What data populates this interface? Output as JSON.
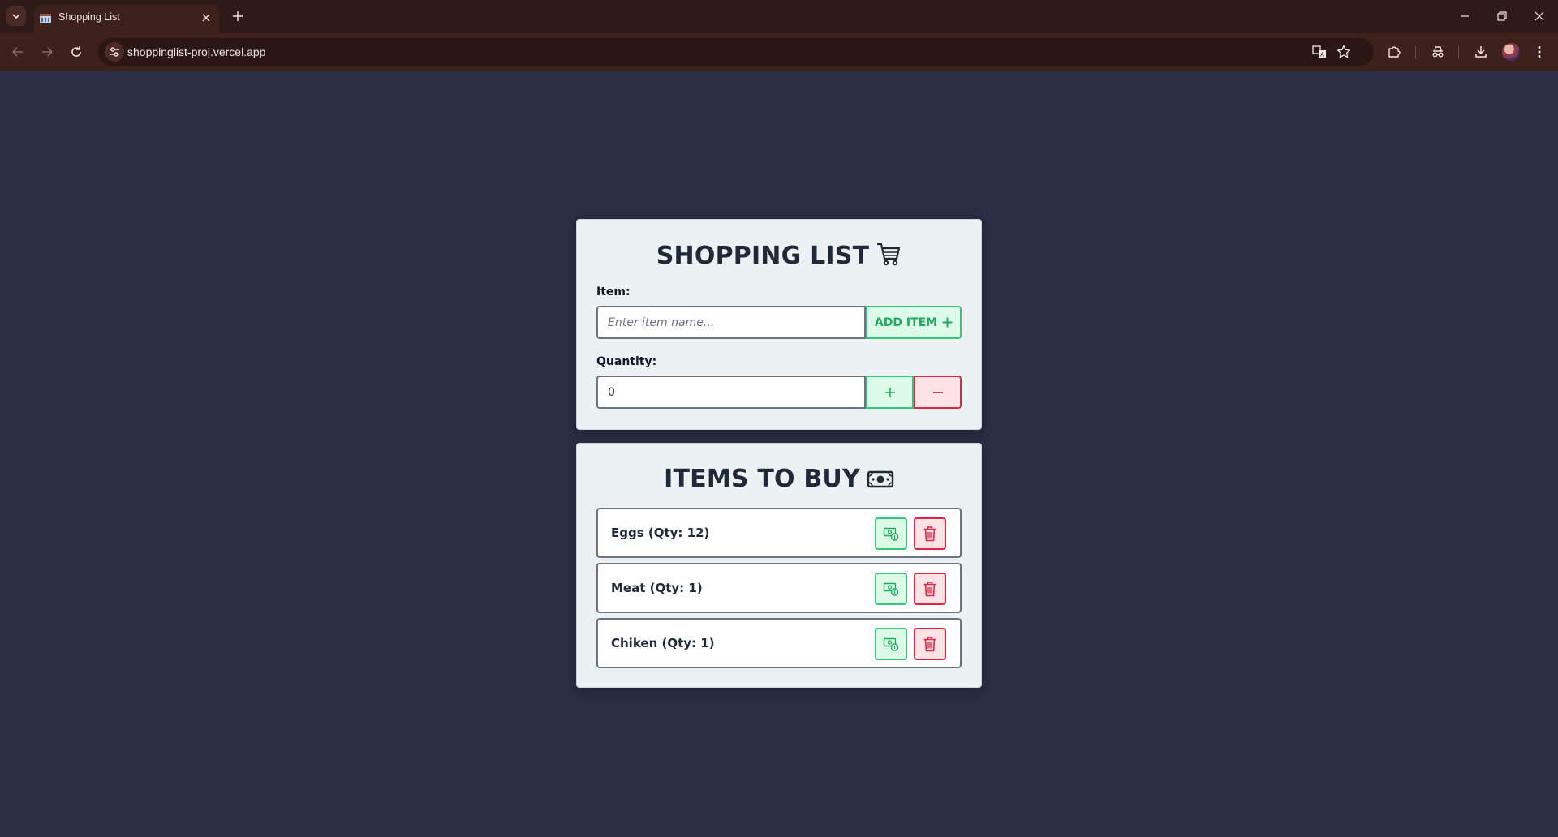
{
  "browser": {
    "tab_title": "Shopping List",
    "url": "shoppinglist-proj.vercel.app"
  },
  "form": {
    "title": "SHOPPING LIST",
    "item_label": "Item:",
    "item_placeholder": "Enter item name...",
    "add_button_label": "ADD ITEM",
    "quantity_label": "Quantity:",
    "quantity_value": "0"
  },
  "list": {
    "title": "ITEMS TO BUY",
    "items": [
      {
        "label": "Eggs (Qty: 12)"
      },
      {
        "label": "Meat (Qty: 1)"
      },
      {
        "label": "Chiken (Qty: 1)"
      }
    ]
  },
  "icons": {
    "form_title": "shopping-cart-icon",
    "list_title": "banknote-icon",
    "buy": "money-check-icon",
    "delete": "trash-icon"
  },
  "colors": {
    "background": "#2b2e44",
    "card": "#ecf1f4",
    "success": "#34c77b",
    "danger": "#dc2645"
  }
}
